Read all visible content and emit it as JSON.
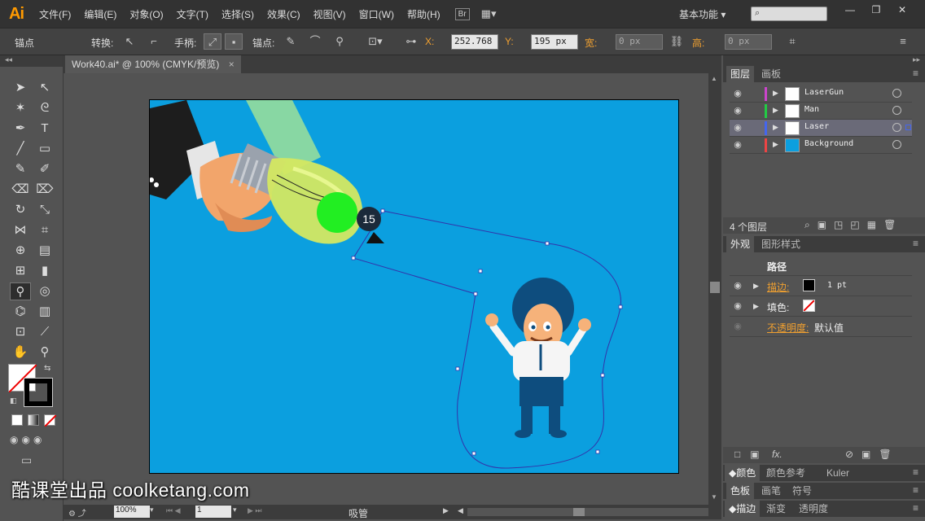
{
  "menubar": {
    "logo": "Ai",
    "items": [
      "文件(F)",
      "编辑(E)",
      "对象(O)",
      "文字(T)",
      "选择(S)",
      "效果(C)",
      "视图(V)",
      "窗口(W)",
      "帮助(H)"
    ],
    "bridge": "Br",
    "workspace": "基本功能",
    "search_placeholder": "",
    "window_buttons": [
      "—",
      "❐",
      "✕"
    ]
  },
  "controlbar": {
    "anchor_label": "锚点",
    "convert_label": "转换:",
    "handle_label": "手柄:",
    "anchor2_label": "锚点:",
    "x_label": "X:",
    "x_value": "252.768 p",
    "y_label": "Y:",
    "y_value": "195 px",
    "w_label": "宽:",
    "w_value": "0 px",
    "h_label": "高:",
    "h_value": "0 px"
  },
  "document": {
    "tab_title": "Work40.ai* @ 100% (CMYK/预览)",
    "tab_close": "×"
  },
  "canvas": {
    "tooltip_number": "15",
    "background_color": "#0b9fdf",
    "bulb_glow_color": "#22ee22"
  },
  "statusbar": {
    "zoom": "100%",
    "page": "1",
    "tool_name": "吸管"
  },
  "layers_panel": {
    "tabs": [
      "图层",
      "画板"
    ],
    "layers": [
      {
        "name": "LaserGun",
        "color": "#cc44cc"
      },
      {
        "name": "Man",
        "color": "#22cc44"
      },
      {
        "name": "Laser",
        "color": "#4466ee"
      },
      {
        "name": "Background",
        "color": "#ee4444"
      }
    ],
    "footer_count": "4 个图层"
  },
  "appearance_panel": {
    "tabs": [
      "外观",
      "图形样式"
    ],
    "title": "路径",
    "stroke_label": "描边:",
    "stroke_value": "1 pt",
    "fill_label": "填色:",
    "opacity_label": "不透明度:",
    "opacity_value": "默认值",
    "footer_fx": "fx."
  },
  "collapsed_panels": [
    [
      "颜色",
      "颜色参考",
      "Kuler"
    ],
    [
      "色板",
      "画笔",
      "符号"
    ],
    [
      "描边",
      "渐变",
      "透明度"
    ]
  ],
  "watermark": "酷课堂出品 coolketang.com"
}
